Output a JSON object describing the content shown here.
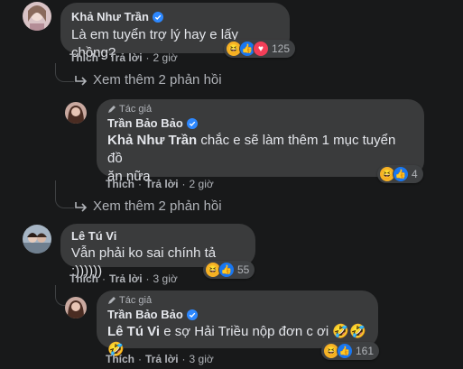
{
  "comments": [
    {
      "author": "Khả Như Trần",
      "text": "Là em tuyển trợ lý hay e lấy chồng?",
      "reaction_count": "125",
      "reactions": [
        "haha",
        "like",
        "love"
      ],
      "actions": {
        "like": "Thích",
        "reply": "Trả lời",
        "time": "2 giờ"
      },
      "more_replies": "Xem thêm 2 phản hồi"
    },
    {
      "author_tag": "Tác giả",
      "author": "Trần Bảo Bảo",
      "mention": "Khả Như Trần",
      "text_line1": " chắc e sẽ làm thêm 1 mục tuyển đồ",
      "text_line2": "ăn nữa",
      "reaction_count": "4",
      "reactions": [
        "haha",
        "like"
      ],
      "actions": {
        "like": "Thích",
        "reply": "Trả lời",
        "time": "2 giờ"
      },
      "more_replies": "Xem thêm 2 phản hồi"
    },
    {
      "author": "Lê Tú Vi",
      "text": "Vẫn phải ko sai chính tả :))))))",
      "reaction_count": "55",
      "reactions": [
        "haha",
        "like"
      ],
      "actions": {
        "like": "Thích",
        "reply": "Trả lời",
        "time": "3 giờ"
      }
    },
    {
      "author_tag": "Tác giả",
      "author": "Trần Bảo Bảo",
      "mention": "Lê Tú Vi",
      "text": " e sợ Hải Triều nộp đơn c ơi 🤣🤣🤣",
      "reaction_count": "161",
      "reactions": [
        "haha",
        "like"
      ],
      "actions": {
        "like": "Thích",
        "reply": "Trả lời",
        "time": "3 giờ"
      }
    }
  ],
  "colors": {
    "background": "#18191a",
    "bubble": "#3a3b3c",
    "verified": "#2d88ff"
  }
}
